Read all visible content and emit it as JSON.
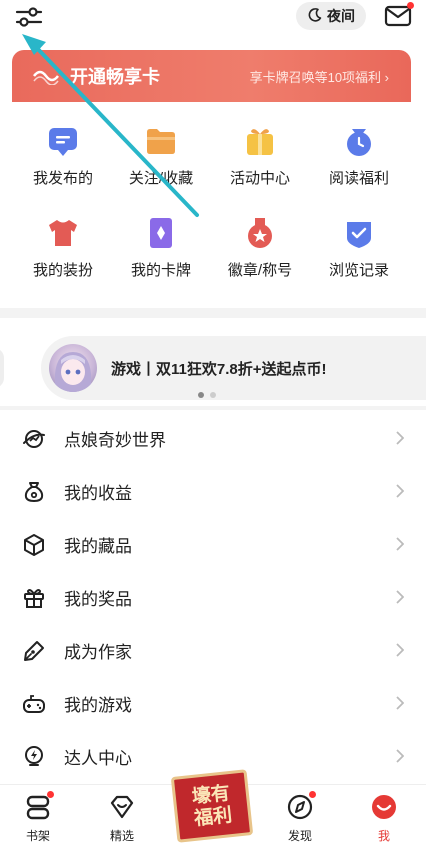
{
  "topbar": {
    "night_label": "夜间",
    "icons": [
      "settings-sliders-icon",
      "moon-icon",
      "mail-icon"
    ]
  },
  "vip": {
    "title": "开通畅享卡",
    "subtitle": "享卡牌召唤等10项福利 ›"
  },
  "grid": [
    {
      "label": "我发布的",
      "icon": "posts-icon",
      "color": "#5b7be9"
    },
    {
      "label": "关注/收藏",
      "icon": "folder-icon",
      "color": "#f0a24a"
    },
    {
      "label": "活动中心",
      "icon": "gift-box-icon",
      "color": "#f5c244"
    },
    {
      "label": "阅读福利",
      "icon": "clock-bag-icon",
      "color": "#5b7be9"
    },
    {
      "label": "我的装扮",
      "icon": "tshirt-icon",
      "color": "#e35b55"
    },
    {
      "label": "我的卡牌",
      "icon": "card-icon",
      "color": "#8a6ae8"
    },
    {
      "label": "徽章/称号",
      "icon": "medal-icon",
      "color": "#e35b55"
    },
    {
      "label": "浏览记录",
      "icon": "shield-check-icon",
      "color": "#5b7be9"
    }
  ],
  "promo": {
    "text": "游戏丨双11狂欢7.8折+送起点币!"
  },
  "menu": [
    {
      "label": "点娘奇妙世界",
      "icon": "planet-icon"
    },
    {
      "label": "我的收益",
      "icon": "money-bag-icon"
    },
    {
      "label": "我的藏品",
      "icon": "cube-icon"
    },
    {
      "label": "我的奖品",
      "icon": "gift-icon"
    },
    {
      "label": "成为作家",
      "icon": "pen-icon"
    },
    {
      "label": "我的游戏",
      "icon": "gamepad-icon"
    },
    {
      "label": "达人中心",
      "icon": "bolt-badge-icon"
    }
  ],
  "tabs": [
    {
      "label": "书架",
      "icon": "bookshelf-icon"
    },
    {
      "label": "精选",
      "icon": "diamond-icon"
    },
    {
      "label": "发现",
      "icon": "compass-icon"
    },
    {
      "label": "我",
      "icon": "smile-face-icon"
    }
  ],
  "center_badge": {
    "line1": "壕有",
    "line2": "福利"
  },
  "colors": {
    "accent": "#e53935",
    "arrow": "#29b6c9"
  }
}
